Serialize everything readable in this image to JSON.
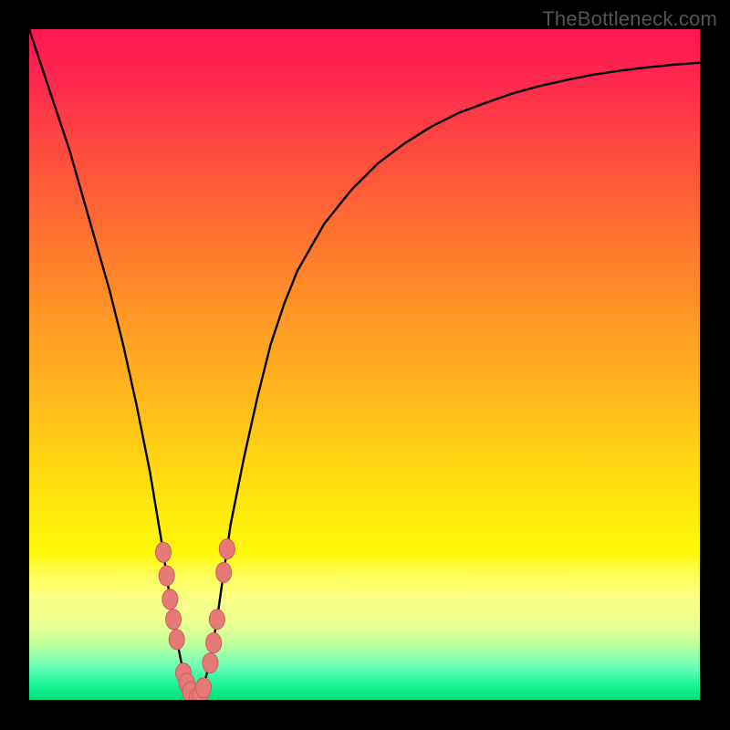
{
  "watermark": "TheBottleneck.com",
  "colors": {
    "frame": "#000000",
    "curve": "#000000",
    "marker_fill": "#e67a78",
    "marker_stroke": "#cf5a58"
  },
  "chart_data": {
    "type": "line",
    "title": "",
    "xlabel": "",
    "ylabel": "",
    "xlim": [
      0,
      100
    ],
    "ylim": [
      0,
      100
    ],
    "x": [
      0,
      2,
      4,
      6,
      8,
      10,
      12,
      14,
      16,
      18,
      20,
      21,
      22,
      23,
      24,
      25,
      26,
      27,
      28,
      29,
      30,
      32,
      34,
      36,
      38,
      40,
      44,
      48,
      52,
      56,
      60,
      64,
      68,
      72,
      76,
      80,
      84,
      88,
      92,
      96,
      100
    ],
    "values": [
      100,
      94,
      88,
      82,
      75,
      68,
      61,
      53,
      44,
      34,
      22,
      15,
      9,
      4,
      1,
      0,
      2,
      6,
      12,
      19,
      26,
      36,
      45,
      53,
      59,
      64,
      71,
      76,
      80,
      83,
      85.5,
      87.5,
      89,
      90.4,
      91.5,
      92.4,
      93.2,
      93.8,
      94.3,
      94.7,
      95
    ],
    "optimum_x": 25,
    "markers": [
      {
        "x": 20.0,
        "y": 22.0
      },
      {
        "x": 20.5,
        "y": 18.5
      },
      {
        "x": 21.0,
        "y": 15.0
      },
      {
        "x": 21.5,
        "y": 12.0
      },
      {
        "x": 22.0,
        "y": 9.0
      },
      {
        "x": 23.0,
        "y": 4.0
      },
      {
        "x": 23.5,
        "y": 2.5
      },
      {
        "x": 24.0,
        "y": 1.2
      },
      {
        "x": 25.0,
        "y": 0.3
      },
      {
        "x": 25.5,
        "y": 0.6
      },
      {
        "x": 26.0,
        "y": 1.8
      },
      {
        "x": 27.0,
        "y": 5.5
      },
      {
        "x": 27.5,
        "y": 8.5
      },
      {
        "x": 28.0,
        "y": 12.0
      },
      {
        "x": 29.0,
        "y": 19.0
      },
      {
        "x": 29.5,
        "y": 22.5
      }
    ]
  }
}
